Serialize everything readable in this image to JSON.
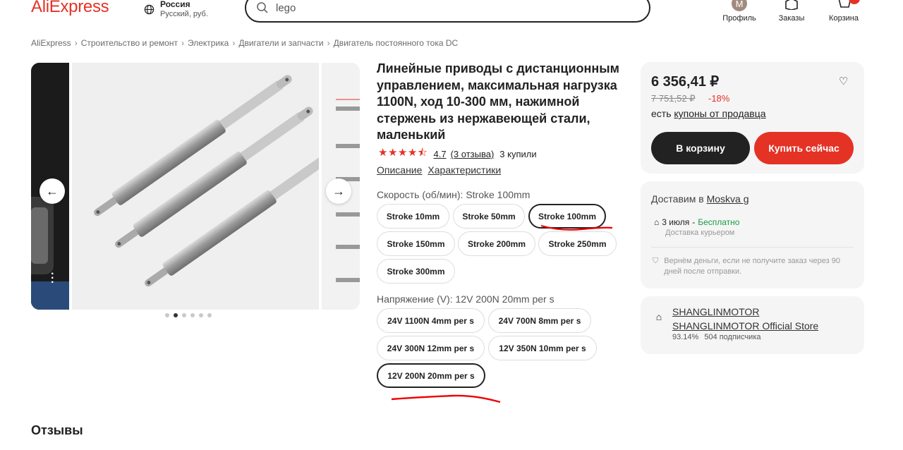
{
  "header": {
    "logo": "AliExpress",
    "region_country": "Россия",
    "region_sub": "Русский, руб.",
    "search_value": "lego",
    "profile_initial": "M",
    "profile_label": "Профиль",
    "orders_label": "Заказы",
    "cart_label": "Корзина"
  },
  "breadcrumb": [
    "AliExpress",
    "Строительство и ремонт",
    "Электрика",
    "Двигатели и запчасти",
    "Двигатель постоянного тока DC"
  ],
  "gallery": {
    "dots_count": 6,
    "active_dot": 1
  },
  "product": {
    "title": "Линейные приводы с дистанционным управлением, максимальная нагрузка 1100N, ход 10-300 мм, нажимной стержень из нержавеющей стали, маленький",
    "rating": "4.7",
    "reviews": "(3 отзыва)",
    "bought": "3 купили",
    "tab_description": "Описание",
    "tab_specs": "Характеристики",
    "speed_label": "Скорость (об/мин): Stroke 100mm",
    "speed_options": [
      "Stroke 10mm",
      "Stroke 50mm",
      "Stroke 100mm",
      "Stroke 150mm",
      "Stroke 200mm",
      "Stroke 250mm",
      "Stroke 300mm"
    ],
    "speed_selected": "Stroke 100mm",
    "voltage_label": "Напряжение (V): 12V 200N 20mm per s",
    "voltage_options": [
      "24V 1100N 4mm per s",
      "24V 700N 8mm per s",
      "24V 300N 12mm per s",
      "12V 350N 10mm per s",
      "12V 200N 20mm per s"
    ],
    "voltage_selected": "12V 200N 20mm per s"
  },
  "buy": {
    "price": "6 356,41 ₽",
    "old_price": "7 751,52 ₽",
    "discount": "-18%",
    "coupon_prefix": "есть",
    "coupon_link": "купоны от продавца",
    "cart_button": "В корзину",
    "buy_button": "Купить сейчас"
  },
  "delivery": {
    "prefix": "Доставим в",
    "city": "Moskva g",
    "date": "3 июля",
    "dash": "-",
    "price": "Бесплатно",
    "method": "Доставка курьером",
    "refund": "Вернём деньги, если не получите заказ через 90 дней после отправки."
  },
  "store": {
    "name": "SHANGLINMOTOR",
    "official": "SHANGLINMOTOR Official Store",
    "rating": "93.14%",
    "subscribers": "504 подписчика"
  },
  "reviews_section_title": "Отзывы",
  "colors": {
    "brand": "#e43225",
    "dark": "#222222",
    "free": "#1a9c42"
  }
}
